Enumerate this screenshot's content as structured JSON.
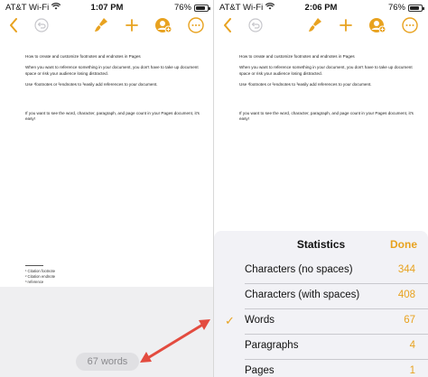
{
  "status_left": {
    "carrier": "AT&T Wi-Fi",
    "time": "1:07 PM",
    "battery": "76%"
  },
  "status_right": {
    "carrier": "AT&T Wi-Fi",
    "time": "2:06 PM",
    "battery": "76%"
  },
  "document": {
    "heading": "How to create and customize footnotes and endnotes in Pages",
    "para1": "When you want to reference something in your document, you don't have to take up document space or risk your audience losing distracted.",
    "para2": "Use ¹footnotes or ²endnotes to ³easily add references to your document.",
    "para3": "If you want to see the word, character, paragraph, and page count in your Pages document, it's easy!"
  },
  "footnotes": [
    "¹ Citation footnote",
    "² Citation endnote",
    "³ reference"
  ],
  "word_count_label": "67 words",
  "statistics": {
    "title": "Statistics",
    "done_label": "Done",
    "rows": [
      {
        "label": "Characters (no spaces)",
        "value": "344",
        "checked": false
      },
      {
        "label": "Characters (with spaces)",
        "value": "408",
        "checked": false
      },
      {
        "label": "Words",
        "value": "67",
        "checked": true
      },
      {
        "label": "Paragraphs",
        "value": "4",
        "checked": false
      },
      {
        "label": "Pages",
        "value": "1",
        "checked": false
      }
    ]
  },
  "colors": {
    "accent": "#e8a21f",
    "arrow": "#e34b3f"
  }
}
